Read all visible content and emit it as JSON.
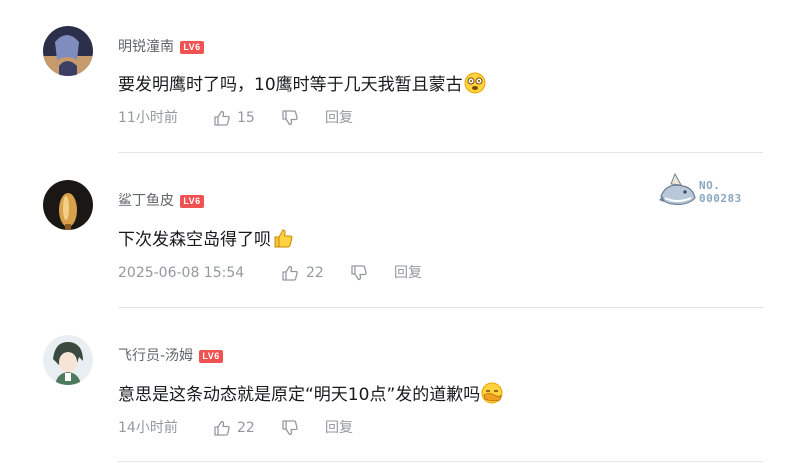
{
  "comments": [
    {
      "username": "明锐潼南",
      "level": "LV6",
      "content": "要发明鹰时了吗，10鹰时等于几天我暂且蒙古",
      "emoji": "dizzy-face-emoji",
      "time": "11小时前",
      "likes": "15",
      "reply_label": "回复"
    },
    {
      "username": "鲨丁鱼皮",
      "level": "LV6",
      "content": "下次发森空岛得了呗",
      "emoji": "thumbs-up-emoji",
      "time": "2025-06-08 15:54",
      "likes": "22",
      "reply_label": "回复"
    },
    {
      "username": "飞行员-汤姆",
      "level": "LV6",
      "content": "意思是这条动态就是原定“明天10点”发的道歉吗",
      "emoji": "hiding-face-emoji",
      "time": "14小时前",
      "likes": "22",
      "reply_label": "回复"
    }
  ],
  "fan_badge": {
    "line1": "NO.",
    "line2": "000283"
  },
  "colors": {
    "username": "#61666d",
    "content": "#18191c",
    "meta": "#9499a0",
    "level_badge": "#f05151",
    "divider": "#e3e5e7"
  }
}
